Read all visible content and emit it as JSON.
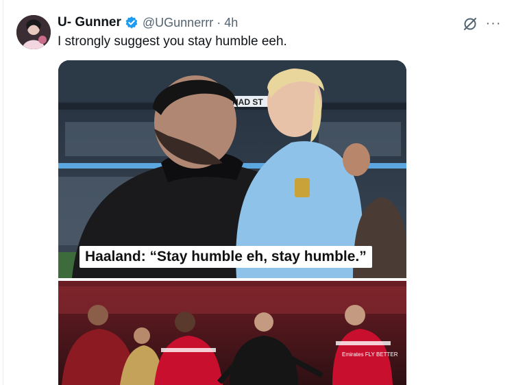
{
  "tweet": {
    "display_name": "U- Gunner",
    "handle": "@UGunnerrr",
    "separator": "·",
    "time": "4h",
    "text": "I strongly suggest you stay humble eeh."
  },
  "media": {
    "caption": "Haaland: “Stay humble eh, stay humble.”",
    "stadium_sign": "HAD ST",
    "jersey_text": "Emirates FLY BETTER"
  },
  "icons": {
    "verified": "verified-badge-icon",
    "grok": "grok-icon",
    "more": "more-icon"
  },
  "colors": {
    "verified_blue": "#1d9bf0",
    "handle_gray": "#536471",
    "city_blue": "#8ec2e8",
    "arsenal_red": "#c8102e"
  }
}
